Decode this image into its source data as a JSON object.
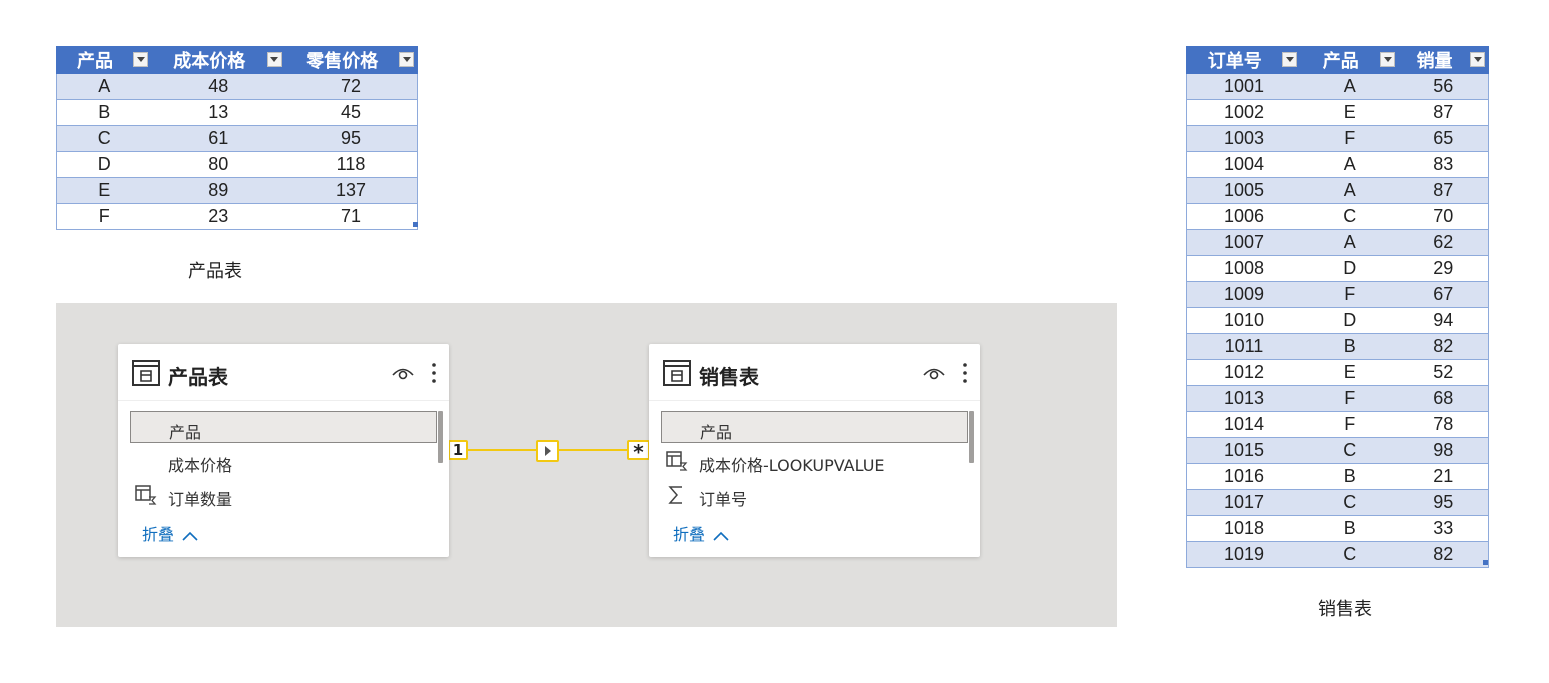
{
  "product_table": {
    "headers": [
      "产品",
      "成本价格",
      "零售价格"
    ],
    "rows": [
      [
        "A",
        "48",
        "72"
      ],
      [
        "B",
        "13",
        "45"
      ],
      [
        "C",
        "61",
        "95"
      ],
      [
        "D",
        "80",
        "118"
      ],
      [
        "E",
        "89",
        "137"
      ],
      [
        "F",
        "23",
        "71"
      ]
    ],
    "caption": "产品表"
  },
  "sales_table": {
    "headers": [
      "订单号",
      "产品",
      "销量"
    ],
    "rows": [
      [
        "1001",
        "A",
        "56"
      ],
      [
        "1002",
        "E",
        "87"
      ],
      [
        "1003",
        "F",
        "65"
      ],
      [
        "1004",
        "A",
        "83"
      ],
      [
        "1005",
        "A",
        "87"
      ],
      [
        "1006",
        "C",
        "70"
      ],
      [
        "1007",
        "A",
        "62"
      ],
      [
        "1008",
        "D",
        "29"
      ],
      [
        "1009",
        "F",
        "67"
      ],
      [
        "1010",
        "D",
        "94"
      ],
      [
        "1011",
        "B",
        "82"
      ],
      [
        "1012",
        "E",
        "52"
      ],
      [
        "1013",
        "F",
        "68"
      ],
      [
        "1014",
        "F",
        "78"
      ],
      [
        "1015",
        "C",
        "98"
      ],
      [
        "1016",
        "B",
        "21"
      ],
      [
        "1017",
        "C",
        "95"
      ],
      [
        "1018",
        "B",
        "33"
      ],
      [
        "1019",
        "C",
        "82"
      ]
    ],
    "caption": "销售表"
  },
  "model_view": {
    "left_card": {
      "title": "产品表",
      "fields": [
        {
          "label": "产品",
          "icon": "none",
          "selected": true
        },
        {
          "label": "成本价格",
          "icon": "none",
          "selected": false
        },
        {
          "label": "订单数量",
          "icon": "calculated-column-icon",
          "selected": false
        }
      ],
      "collapse_label": "折叠"
    },
    "right_card": {
      "title": "销售表",
      "fields": [
        {
          "label": "产品",
          "icon": "none",
          "selected": true
        },
        {
          "label": "成本价格-LOOKUPVALUE",
          "icon": "calculated-column-icon",
          "selected": false
        },
        {
          "label": "订单号",
          "icon": "sigma-icon",
          "selected": false
        }
      ],
      "collapse_label": "折叠"
    },
    "relationship": {
      "from_cardinality": "1",
      "to_cardinality": "*",
      "color": "#f2c811"
    }
  },
  "colors": {
    "header_blue": "#4472c4",
    "band_blue": "#d9e1f2",
    "canvas_gray": "#e0dfdd",
    "link_blue": "#106ebe"
  }
}
